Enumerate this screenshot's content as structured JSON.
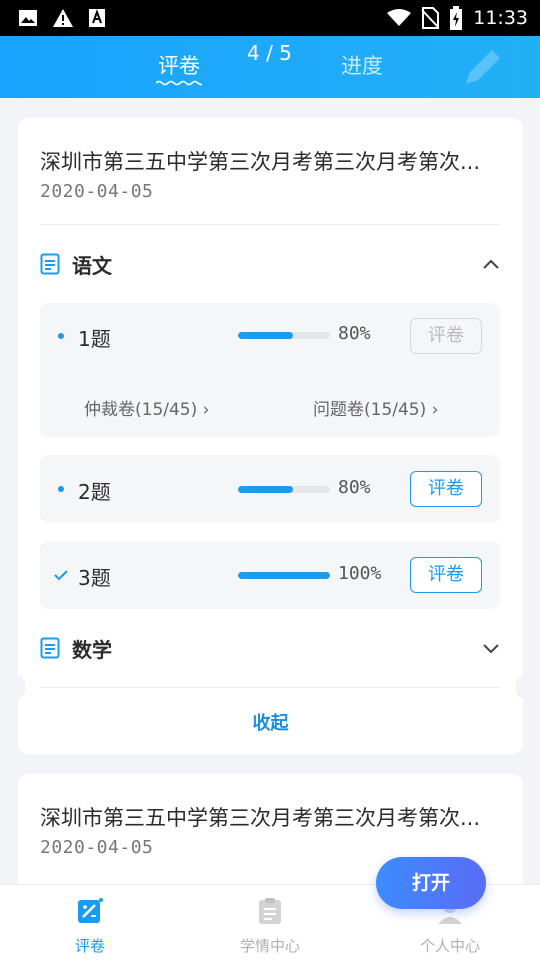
{
  "status_bar": {
    "time": "11:33",
    "left_icons": [
      "image-icon",
      "warning-icon",
      "text-box-icon"
    ],
    "right_icons": [
      "wifi-icon",
      "no-sim-icon",
      "battery-charging-icon"
    ]
  },
  "header": {
    "tabs": [
      {
        "label": "评卷",
        "active": true
      },
      {
        "label": "进度",
        "active": false
      }
    ],
    "pager": "4 / 5",
    "accent_color": "#1aa3ff"
  },
  "exams": [
    {
      "title": "深圳市第三五中学第三次月考第三次月考第次...",
      "date": "2020-04-05",
      "subjects": [
        {
          "name": "语文",
          "expanded": true,
          "questions": [
            {
              "label": "1题",
              "progress": 0.6,
              "percent_text": "80%",
              "button": "评卷",
              "button_enabled": false,
              "done": false,
              "links": [
                {
                  "text": "仲裁卷(15/45) ›"
                },
                {
                  "text": "问题卷(15/45) ›"
                }
              ]
            },
            {
              "label": "2题",
              "progress": 0.6,
              "percent_text": "80%",
              "button": "评卷",
              "button_enabled": true,
              "done": false
            },
            {
              "label": "3题",
              "progress": 1.0,
              "percent_text": "100%",
              "button": "评卷",
              "button_enabled": true,
              "done": true
            }
          ]
        },
        {
          "name": "数学",
          "expanded": false
        }
      ],
      "collapse_label": "收起"
    },
    {
      "title": "深圳市第三五中学第三次月考第三次月考第次...",
      "date": "2020-04-05"
    }
  ],
  "open_button": {
    "label": "打开"
  },
  "bottom_nav": [
    {
      "label": "评卷",
      "icon": "grading-icon",
      "active": true
    },
    {
      "label": "学情中心",
      "icon": "clipboard-icon",
      "active": false
    },
    {
      "label": "个人中心",
      "icon": "user-icon",
      "active": false
    }
  ]
}
